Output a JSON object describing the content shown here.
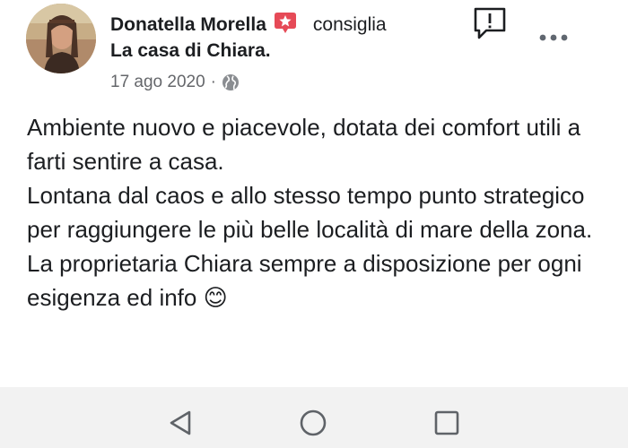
{
  "post": {
    "author": "Donatella Morella",
    "verb": "consiglia",
    "page_name": "La casa di Chiara.",
    "date": "17 ago 2020",
    "separator": "·",
    "paragraphs": [
      "Ambiente nuovo e piacevole, dotata dei comfort utili a farti sentire a casa.",
      "Lontana dal caos e allo stesso tempo punto strategico per raggiungere le più belle località di mare della zona.",
      "La proprietaria Chiara sempre a disposizione per ogni esigenza ed info 😊"
    ]
  },
  "icons": {
    "recommend": "recommend-star-icon",
    "audience": "globe-icon",
    "report": "report-exclamation-icon",
    "more": "more-dots-icon",
    "nav_back": "triangle-back-icon",
    "nav_home": "circle-home-icon",
    "nav_recent": "square-recent-icon"
  },
  "colors": {
    "recommend_badge": "#e64a57",
    "secondary_text": "#65676b",
    "nav_bar_bg": "#f2f2f2"
  }
}
